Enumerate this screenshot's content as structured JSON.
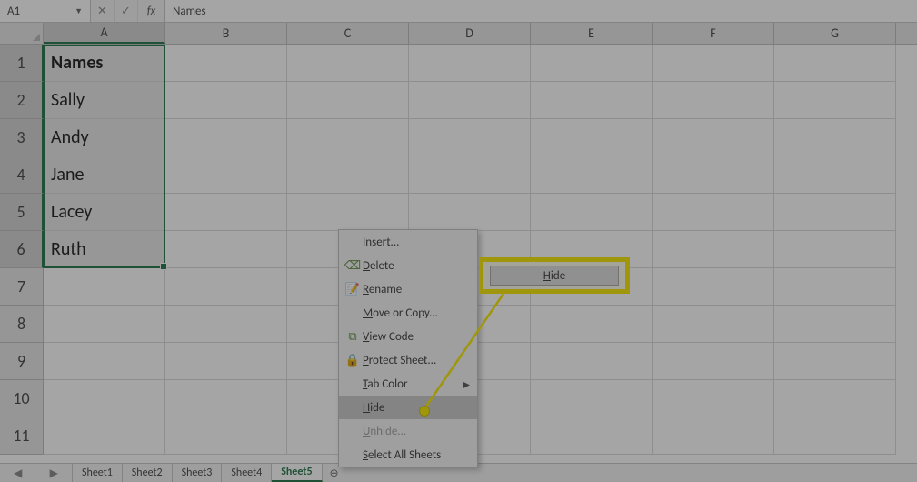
{
  "name_box": "A1",
  "formula_value": "Names",
  "columns": [
    "A",
    "B",
    "C",
    "D",
    "E",
    "F",
    "G"
  ],
  "rows": [
    1,
    2,
    3,
    4,
    5,
    6,
    7,
    8,
    9,
    10,
    11
  ],
  "selected_column_index": 0,
  "selected_rows_through": 6,
  "cells_colA": [
    "Names",
    "Sally",
    "Andy",
    "Jane",
    "Lacey",
    "Ruth",
    "",
    "",
    "",
    "",
    ""
  ],
  "sheet_tabs": [
    "Sheet1",
    "Sheet2",
    "Sheet3",
    "Sheet4",
    "Sheet5"
  ],
  "active_sheet_index": 4,
  "context_menu": {
    "insert": "Insert...",
    "delete": "Delete",
    "rename": "Rename",
    "move_copy": "Move or Copy...",
    "view_code": "View Code",
    "protect": "Protect Sheet...",
    "tab_color": "Tab Color",
    "hide": "Hide",
    "unhide": "Unhide...",
    "select_all": "Select All Sheets"
  },
  "callout_label": "Hide"
}
